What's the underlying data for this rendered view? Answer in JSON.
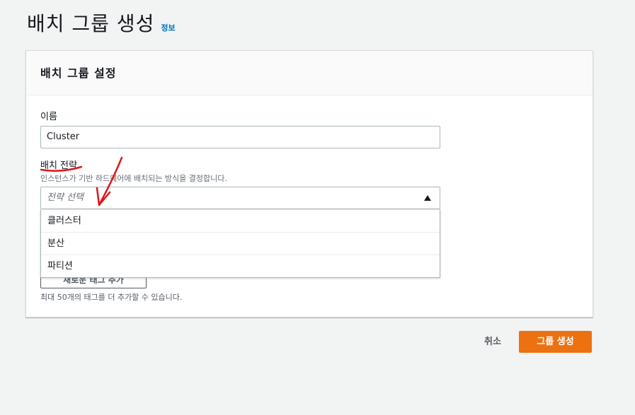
{
  "header": {
    "title": "배치 그룹 생성",
    "info_link": "정보"
  },
  "panel": {
    "title": "배치 그룹 설정",
    "name_field": {
      "label": "이름",
      "value": "Cluster"
    },
    "strategy_field": {
      "label": "배치 전략",
      "description": "인스턴스가 기반 하드웨어에 배치되는 방식을 결정합니다.",
      "placeholder": "전략 선택",
      "options": [
        "클러스터",
        "분산",
        "파티션"
      ]
    },
    "tags": {
      "add_button": "새로운 태그 추가",
      "hint": "최대 50개의 태그를 더 추가할 수 있습니다."
    }
  },
  "footer": {
    "cancel_label": "취소",
    "create_label": "그룹 생성",
    "create_color": "#ec7211"
  },
  "icons": {
    "caret": "caret-up-icon"
  },
  "annotation": {
    "color": "#e0151b"
  }
}
